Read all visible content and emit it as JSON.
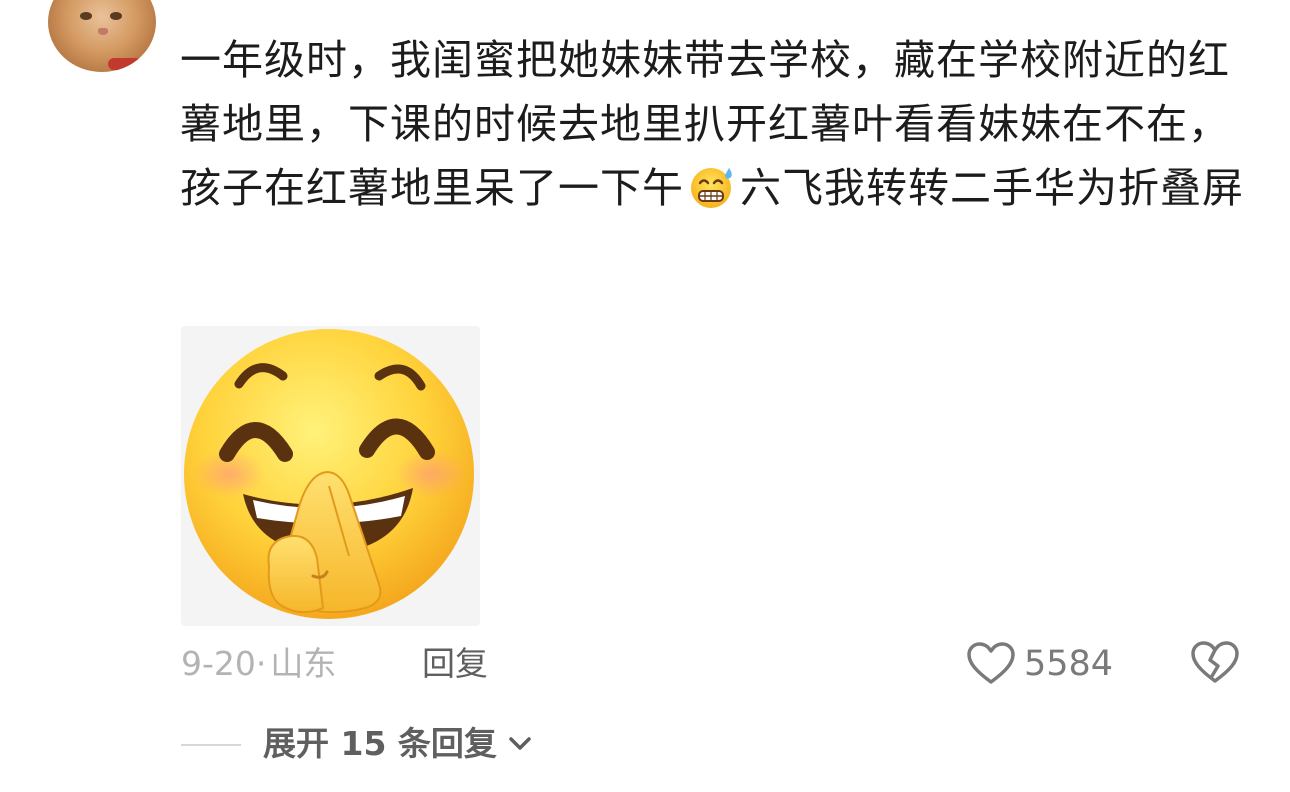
{
  "comment": {
    "username": "",
    "text_before_emoji": "一年级时，我闺蜜把她妹妹带去学校，藏在学校附近的红薯地里，下课的时候去地里扒开红薯叶看看妹妹在不在，孩子在红薯地里呆了一下午",
    "text_after_emoji": "六飞我转转二手华为折叠屏",
    "inline_emoji": "grin-sweat-emoji",
    "sticker": "laughing-covering-mouth-emoji-sticker",
    "date": "9-20",
    "separator": "·",
    "location": "山东",
    "reply_label": "回复",
    "like_count": "5584"
  },
  "expand": {
    "label": "展开 15 条回复"
  },
  "colors": {
    "text": "#1c1c1c",
    "meta": "#b3b3b3",
    "action": "#5f5f5f",
    "emoji_yellow": "#ffc928"
  }
}
